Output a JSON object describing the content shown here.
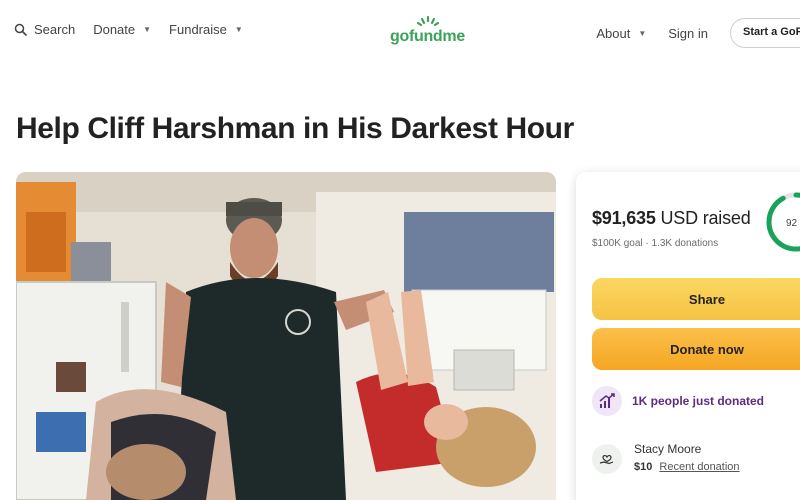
{
  "header": {
    "search_label": "Search",
    "donate_label": "Donate",
    "fundraise_label": "Fundraise",
    "logo_text": "gofundme",
    "about_label": "About",
    "signin_label": "Sign in",
    "start_label": "Start a GoFu"
  },
  "campaign": {
    "title": "Help Cliff Harshman in His Darkest Hour",
    "photo_icon": "campaign-photo"
  },
  "donation": {
    "amount": "$91,635",
    "currency_label": "USD raised",
    "goal": "$100K goal",
    "separator": "·",
    "donations_count": "1.3K donations",
    "progress_percent": 92,
    "progress_label": "92",
    "share_label": "Share",
    "donate_now_label": "Donate now",
    "recent_text": "1K people just donated",
    "recent_icon": "trending-up-icon",
    "donor": {
      "name": "Stacy Moore",
      "amount": "$10",
      "tag": "Recent donation",
      "icon": "hand-heart-icon"
    }
  },
  "colors": {
    "brand": "#3aa35a",
    "share": "#f8cf55",
    "donate": "#f7b23b",
    "promo": "#5b2c83",
    "ring": "#19a35a"
  }
}
